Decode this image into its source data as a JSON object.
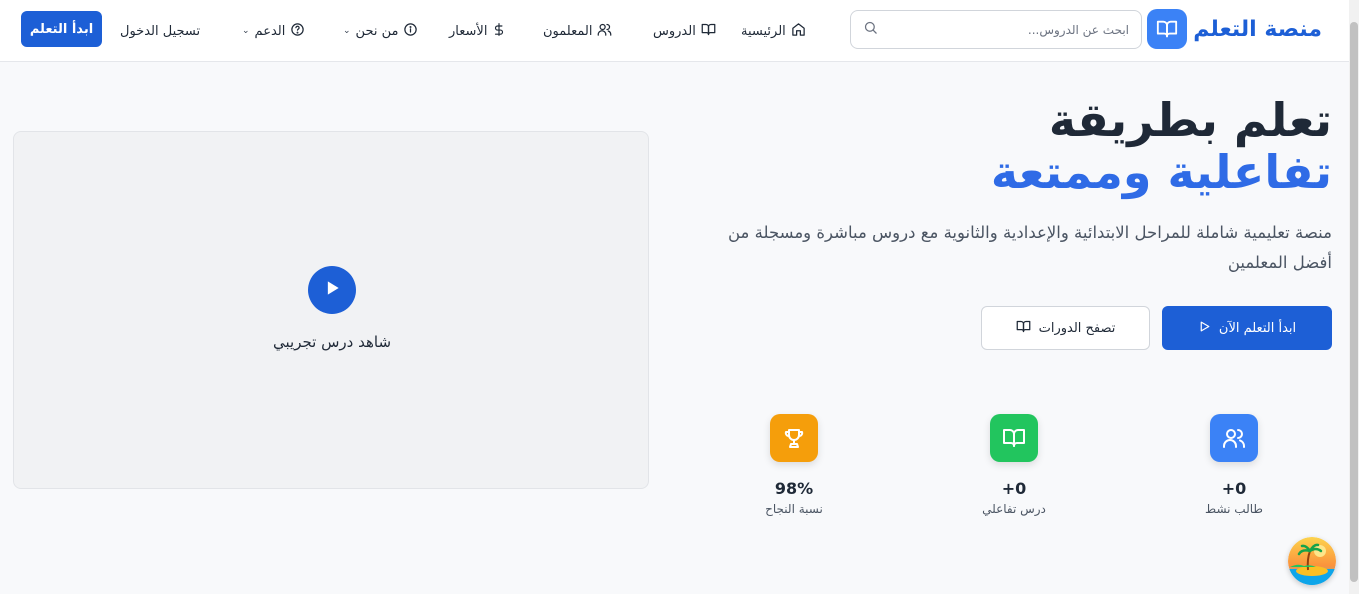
{
  "header": {
    "brand": "منصة التعلم",
    "search_placeholder": "ابحث عن الدروس...",
    "nav": {
      "home": "الرئيسية",
      "lessons": "الدروس",
      "teachers": "المعلمون",
      "pricing": "الأسعار",
      "about": "من نحن",
      "support": "الدعم"
    },
    "login": "تسجيل الدخول",
    "cta": "ابدأ التعلم"
  },
  "hero": {
    "title_line1": "تعلم بطريقة",
    "title_line2": "تفاعلية وممتعة",
    "subtitle": "منصة تعليمية شاملة للمراحل الابتدائية والإعدادية والثانوية مع دروس مباشرة ومسجلة من أفضل المعلمين",
    "primary_button": "ابدأ التعلم الآن",
    "secondary_button": "تصفح الدورات"
  },
  "stats": [
    {
      "value": "0+",
      "label": "طالب نشط",
      "icon": "users-icon",
      "color": "#3b82f6"
    },
    {
      "value": "0+",
      "label": "درس تفاعلي",
      "icon": "book-open-icon",
      "color": "#22c55e"
    },
    {
      "value": "98%",
      "label": "نسبة النجاح",
      "icon": "trophy-icon",
      "color": "#f59e0b"
    }
  ],
  "video": {
    "label": "شاهد درس تجريبي"
  },
  "colors": {
    "primary": "#1d5fd6",
    "accent_blue": "#2f6be6"
  }
}
